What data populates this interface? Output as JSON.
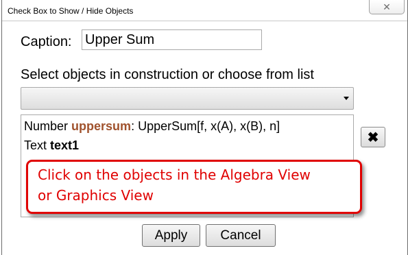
{
  "window": {
    "title": "Check Box to Show / Hide Objects",
    "close_symbol": "✕"
  },
  "caption": {
    "label": "Caption:",
    "value": "Upper Sum"
  },
  "select": {
    "label": "Select objects in construction or choose from list",
    "dropdown_value": ""
  },
  "objects": [
    {
      "type_word": "Number",
      "name": "uppersum",
      "definition": ": UpperSum[f, x(A), x(B), n]"
    },
    {
      "type_word": "Text",
      "name": "text1"
    }
  ],
  "remove_button": {
    "label": "✖"
  },
  "callout": {
    "line1": "Click on the objects in the Algebra View",
    "line2": "or Graphics View",
    "color": "#e00000"
  },
  "buttons": {
    "apply": "Apply",
    "cancel": "Cancel"
  },
  "colors": {
    "object_name_highlight": "#a0522d"
  }
}
